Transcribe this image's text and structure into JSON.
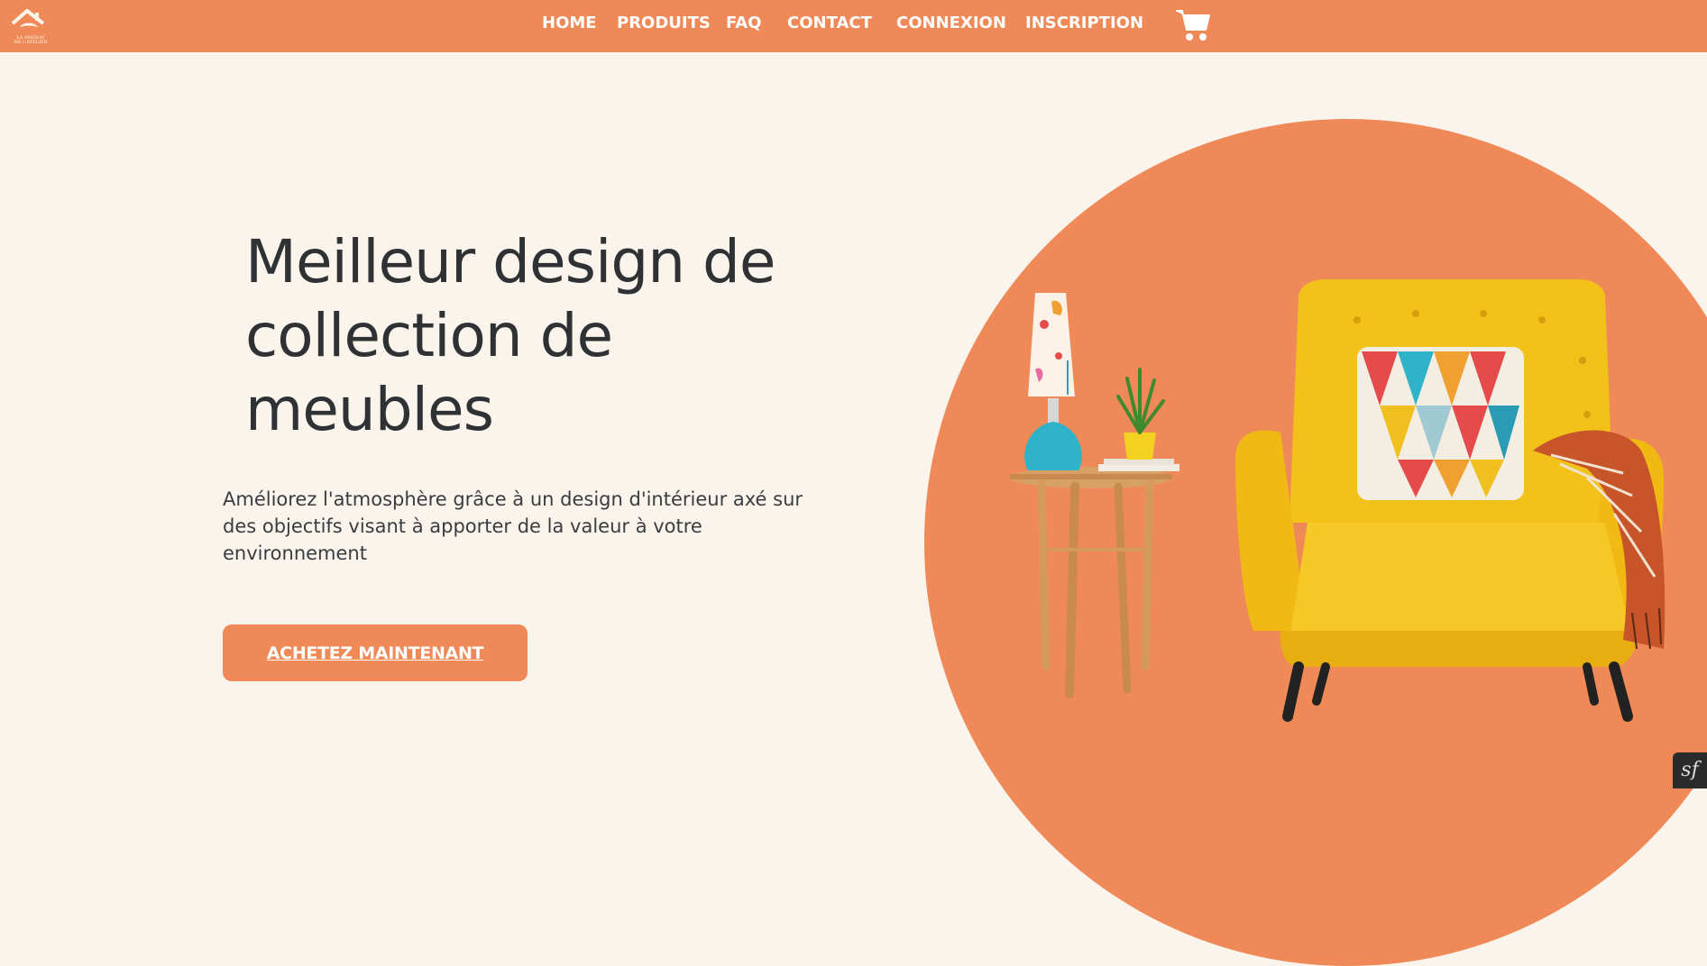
{
  "brand": {
    "logo_text_line1": "LA MAISON",
    "logo_text_line2": "DE L'ATELIER"
  },
  "nav": {
    "items": [
      {
        "label": "HOME"
      },
      {
        "label": "PRODUITS"
      },
      {
        "label": "FAQ"
      },
      {
        "label": "CONTACT"
      },
      {
        "label": "CONNEXION"
      },
      {
        "label": "INSCRIPTION"
      }
    ],
    "cart_icon": "shopping-cart-icon"
  },
  "hero": {
    "title_line1": "Meilleur design de",
    "title_line2": "collection de",
    "title_line3": "meubles",
    "subtitle_line1": "Améliorez l'atmosphère grâce à un design d'intérieur axé sur",
    "subtitle_line2": "des objectifs visant à apporter de la valeur à votre",
    "subtitle_line3": "environnement",
    "cta_label": "ACHETEZ MAINTENANT"
  },
  "debug_badge": {
    "glyph": "sf"
  },
  "colors": {
    "accent": "#ef8a58",
    "background": "#fbf4ec",
    "text_dark": "#2f3234",
    "chair_yellow": "#f2c21b",
    "lamp_blue": "#2fb3c9"
  }
}
